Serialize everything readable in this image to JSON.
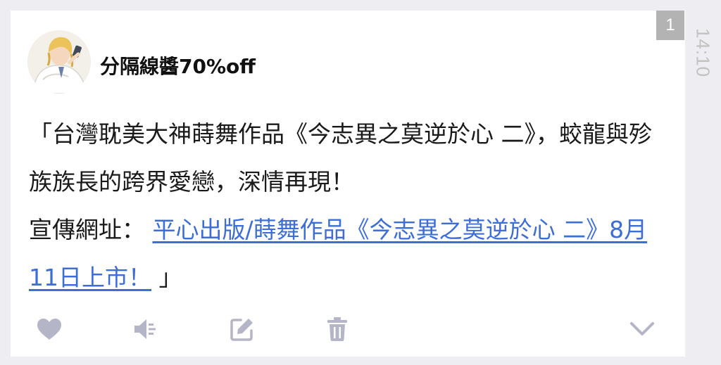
{
  "post": {
    "unread_count": "1",
    "author": "分隔線醬70%off",
    "timestamp": "14:10",
    "text_line1": "「台灣耽美大神蒔舞作品《今志異之莫逆於心 二》，蛟龍與殄族族長的跨界愛戀，深情再現！",
    "text_line2_prefix": "宣傳網址：",
    "link_text": "平心出版/蒔舞作品《今志異之莫逆於心 二》8月11日上市！",
    "text_suffix": "」"
  },
  "actions": [
    {
      "icon": "heart-icon"
    },
    {
      "icon": "speaker-icon"
    },
    {
      "icon": "edit-icon"
    },
    {
      "icon": "trash-icon"
    },
    {
      "icon": "chevron-down-icon"
    }
  ],
  "colors": {
    "background": "#ededf2",
    "card": "#ffffff",
    "link": "#3d6ed6",
    "icon": "#b5b5c8",
    "badge": "#b3b3b3",
    "timestamp": "#c2c2c2"
  }
}
